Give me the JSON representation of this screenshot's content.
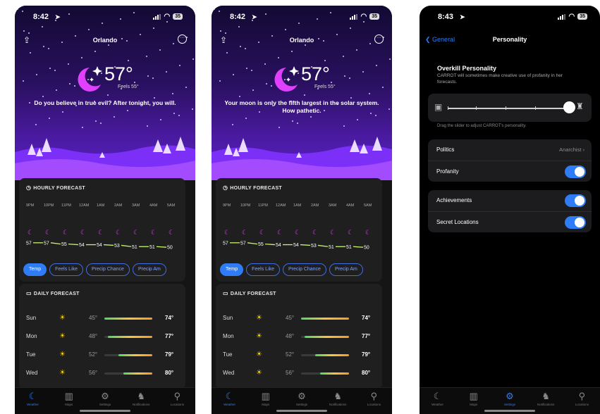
{
  "colors": {
    "accent": "#2f7cf6",
    "moon": "#e040fb",
    "sun": "#ffd400",
    "sky_top": "#120a33",
    "sky_bottom": "#5a22c8"
  },
  "weather": {
    "time": "8:42",
    "city": "Orlando",
    "temp": "57°",
    "feels_like": "Feels 55°",
    "quotes": [
      "Do you believe in true evil? After tonight, you will.",
      "Your moon is only the fifth largest in the solar system. How pathetic."
    ],
    "hourly": {
      "title": "HOURLY FORECAST",
      "hours": [
        "9PM",
        "10PM",
        "11PM",
        "12AM",
        "1AM",
        "2AM",
        "3AM",
        "4AM",
        "5AM"
      ],
      "temps": [
        57,
        57,
        55,
        54,
        54,
        53,
        51,
        51,
        50
      ],
      "temp_labels": [
        "57",
        "57",
        "55",
        "54",
        "54",
        "53",
        "51",
        "51",
        "50"
      ],
      "icon": "moon-icon",
      "pills": [
        "Temp",
        "Feels Like",
        "Precip Chance",
        "Precip Am"
      ],
      "active_pill": "Temp"
    },
    "daily": {
      "title": "DAILY FORECAST",
      "days": [
        {
          "day": "Sun",
          "low": "45°",
          "high": "74°",
          "range": [
            0.0,
            1.0
          ]
        },
        {
          "day": "Mon",
          "low": "48°",
          "high": "77°",
          "range": [
            0.08,
            1.0
          ]
        },
        {
          "day": "Tue",
          "low": "52°",
          "high": "79°",
          "range": [
            0.3,
            1.0
          ]
        },
        {
          "day": "Wed",
          "low": "56°",
          "high": "80°",
          "range": [
            0.4,
            1.0
          ]
        }
      ]
    }
  },
  "tabs": [
    {
      "label": "Weather",
      "icon": "moon-icon"
    },
    {
      "label": "Maps",
      "icon": "map-icon"
    },
    {
      "label": "Settings",
      "icon": "gear-icon"
    },
    {
      "label": "Notifications",
      "icon": "bell-icon"
    },
    {
      "label": "Locations",
      "icon": "location-pin-icon"
    }
  ],
  "settings": {
    "time": "8:43",
    "back_label": "General",
    "title": "Personality",
    "section_title": "Overkill Personality",
    "section_subtitle": "CARROT will sometimes make creative use of profanity in her forecasts.",
    "slider_hint": "Drag the slider to adjust CARROT's personality.",
    "slider_level": 1.0,
    "rows_group1": [
      {
        "label": "Politics",
        "value": "Anarchist"
      },
      {
        "label": "Profanity",
        "toggle": true
      }
    ],
    "rows_group2": [
      {
        "label": "Achievements",
        "toggle": true
      },
      {
        "label": "Secret Locations",
        "toggle": true
      }
    ]
  }
}
